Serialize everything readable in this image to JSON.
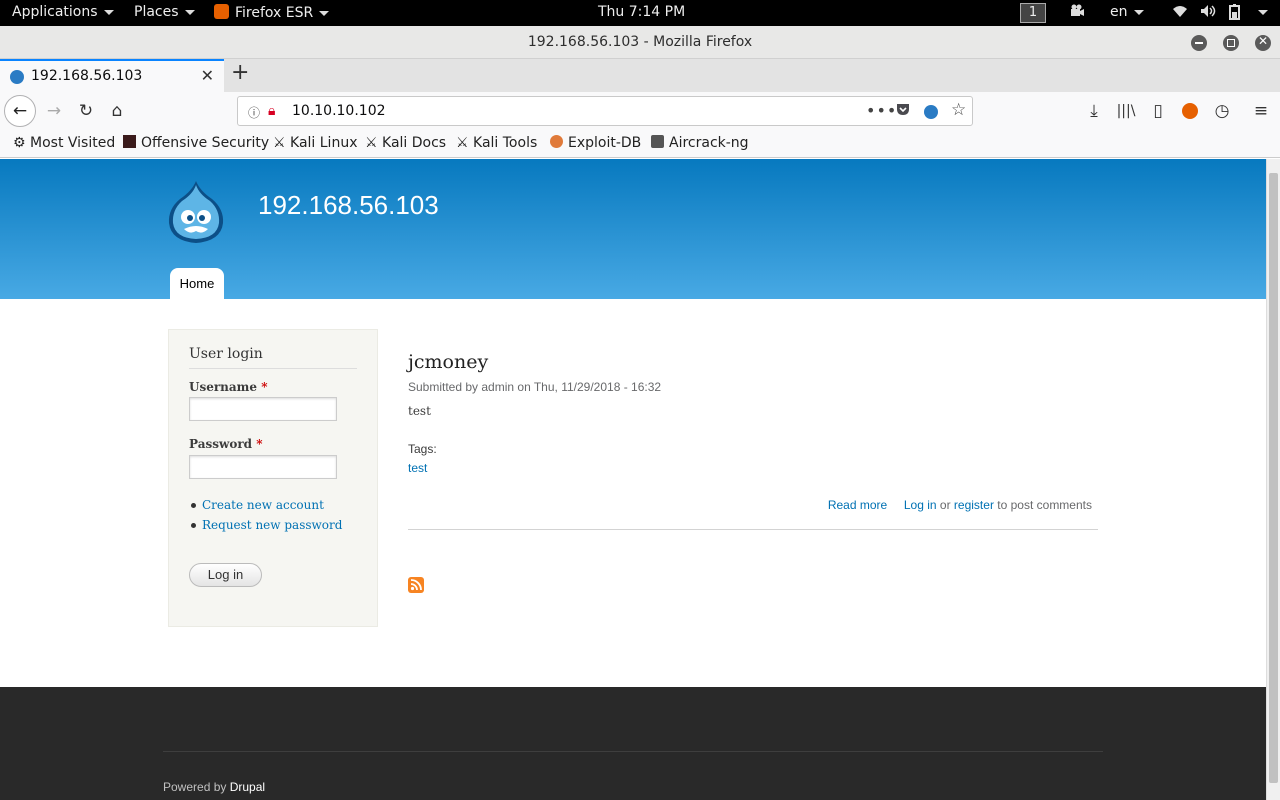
{
  "gnome": {
    "applications": "Applications",
    "places": "Places",
    "firefox": "Firefox ESR",
    "clock": "Thu  7:14 PM",
    "workspace": "1",
    "lang": "en"
  },
  "window": {
    "title": "192.168.56.103 - Mozilla Firefox"
  },
  "tab": {
    "label": "192.168.56.103"
  },
  "urlbar": {
    "value": "10.10.10.102"
  },
  "bookmarks": [
    {
      "label": "Most Visited"
    },
    {
      "label": "Offensive Security"
    },
    {
      "label": "Kali Linux"
    },
    {
      "label": "Kali Docs"
    },
    {
      "label": "Kali Tools"
    },
    {
      "label": "Exploit-DB"
    },
    {
      "label": "Aircrack-ng"
    }
  ],
  "site": {
    "name": "192.168.56.103",
    "nav_home": "Home"
  },
  "login": {
    "title": "User login",
    "username_label": "Username",
    "password_label": "Password",
    "required": "*",
    "create_account": "Create new account",
    "request_password": "Request new password",
    "button": "Log in"
  },
  "article": {
    "title": "jcmoney",
    "meta": "Submitted by admin on Thu, 11/29/2018 - 16:32",
    "body": "test",
    "tags_label": "Tags:",
    "tag": "test",
    "read_more": "Read more",
    "log_in": "Log in",
    "or": "or",
    "register": "register",
    "to_post": "to post comments"
  },
  "footer": {
    "powered_by": "Powered by",
    "drupal": "Drupal"
  }
}
